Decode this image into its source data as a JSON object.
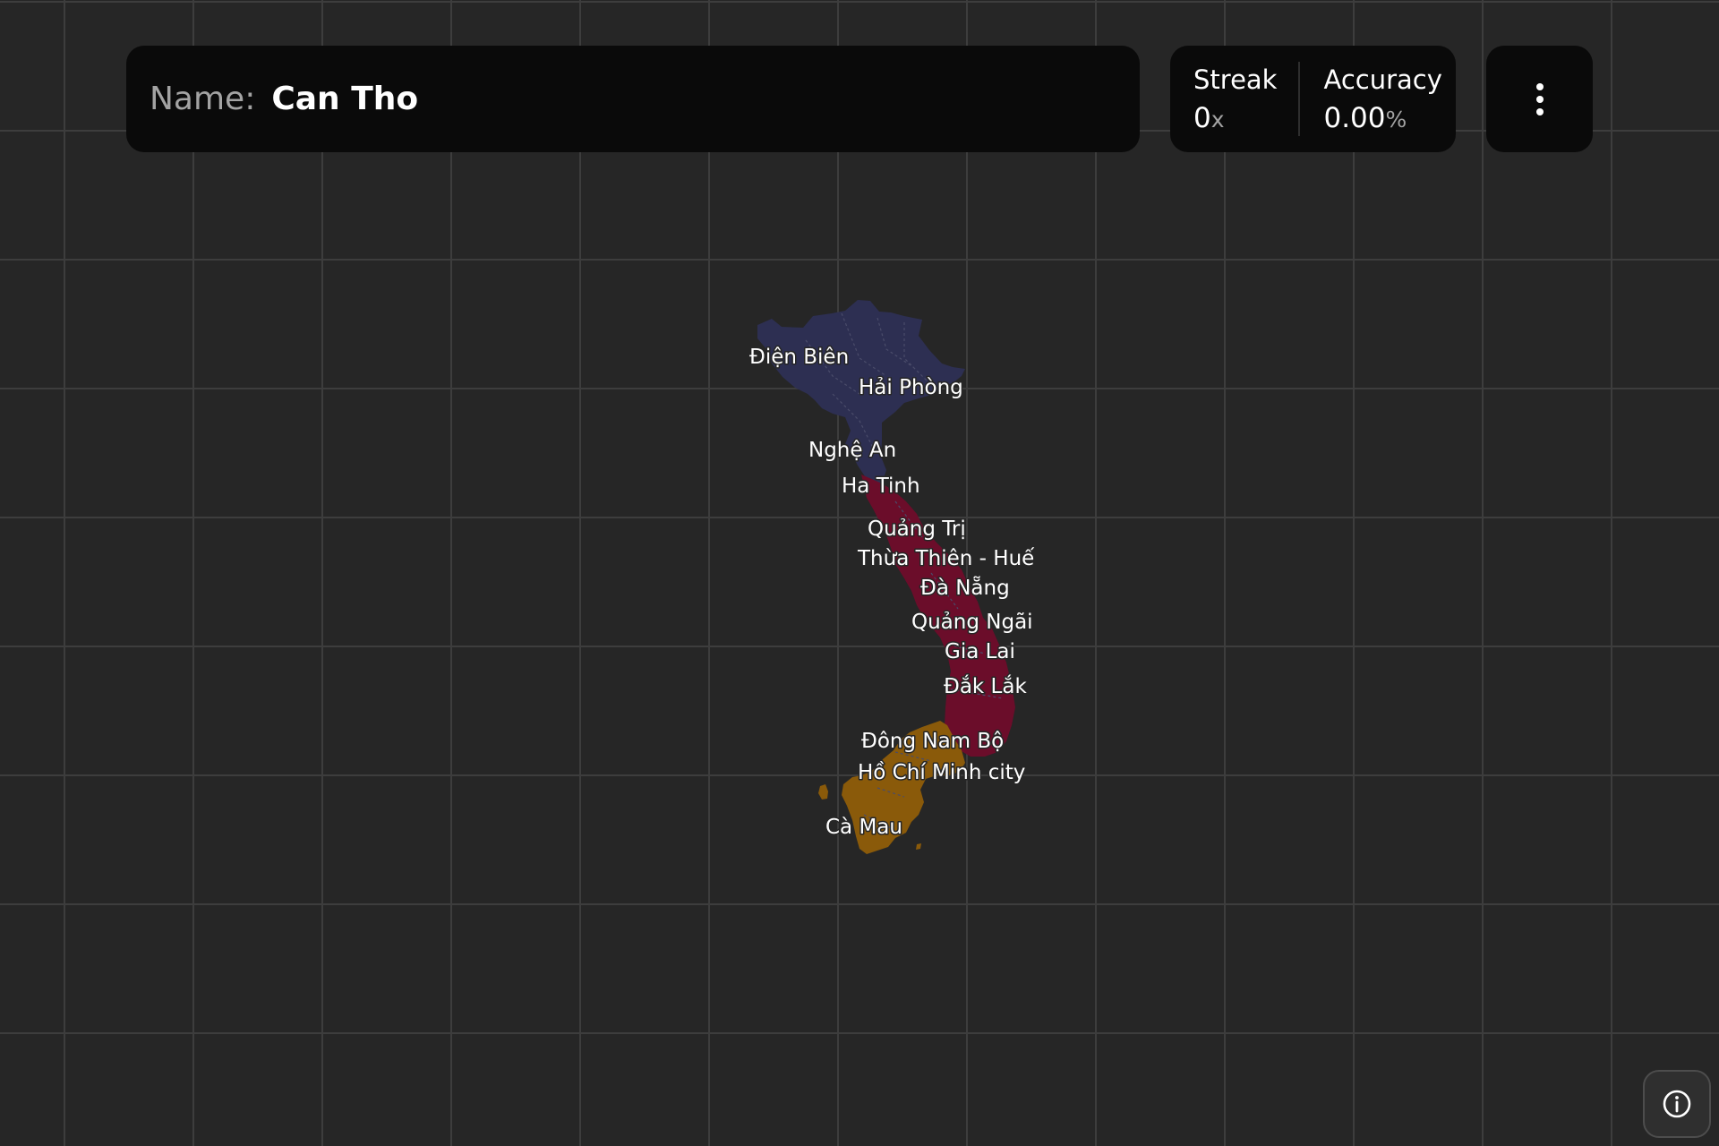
{
  "header": {
    "name_label": "Name:",
    "name_value": "Can Tho"
  },
  "stats": {
    "streak_label": "Streak",
    "streak_value": "0",
    "streak_unit": "x",
    "accuracy_label": "Accuracy",
    "accuracy_value": "0.00",
    "accuracy_unit": "%"
  },
  "menu": {
    "icon": "more-vertical-icon"
  },
  "info": {
    "icon": "info-circle-icon"
  },
  "map": {
    "colors": {
      "north": "#2d2f52",
      "central": "#6b0d2a",
      "south": "#8a5a0a",
      "background": "#262626",
      "grid": "#3d3d3d"
    },
    "labels": [
      "Điện Biên",
      "Hải Phòng",
      "Nghệ An",
      "Ha Tinh",
      "Quảng Trị",
      "Thừa Thiên - Huế",
      "Đà Nẵng",
      "Quảng Ngãi",
      "Gia Lai",
      "Đắk Lắk",
      "Đông Nam Bộ",
      "Hồ Chí Minh city",
      "Cà Mau"
    ]
  }
}
